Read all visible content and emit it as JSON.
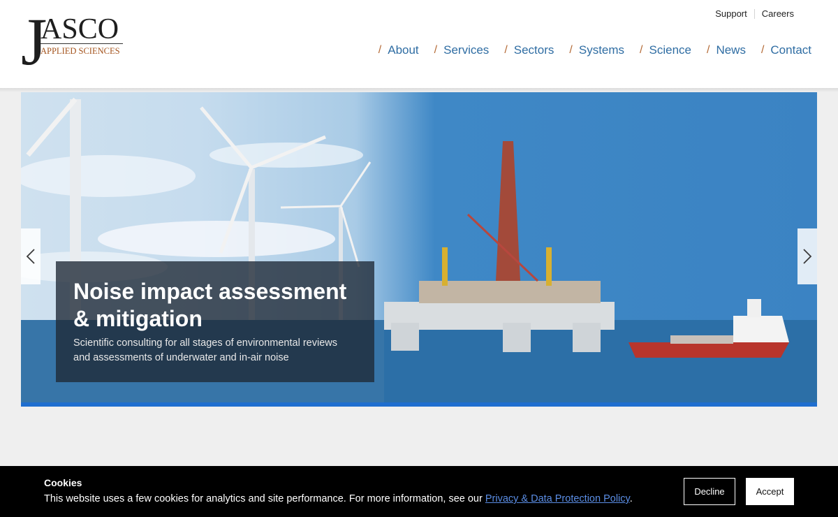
{
  "logo": {
    "initial": "J",
    "rest": "ASCO",
    "tagline": "APPLIED SCIENCES"
  },
  "utility_nav": [
    {
      "label": "Support"
    },
    {
      "label": "Careers"
    }
  ],
  "main_nav": [
    {
      "label": "About"
    },
    {
      "label": "Services"
    },
    {
      "label": "Sectors"
    },
    {
      "label": "Systems"
    },
    {
      "label": "Science"
    },
    {
      "label": "News"
    },
    {
      "label": "Contact"
    }
  ],
  "hero": {
    "title": "Noise impact assessment & mitigation",
    "subtitle": "Scientific consulting for all stages of environmental reviews and assessments of underwater and in-air noise",
    "prev_icon": "chevron-left-icon",
    "next_icon": "chevron-right-icon"
  },
  "cookie_banner": {
    "title": "Cookies",
    "message": "This website uses a few cookies for analytics and site performance. For more information, see our ",
    "link_text": "Privacy & Data Protection Policy",
    "message_end": ".",
    "decline_label": "Decline",
    "accept_label": "Accept"
  },
  "colors": {
    "nav_link": "#2f6da3",
    "nav_slash": "#b46a36",
    "hero_bar": "#1f6ecf",
    "cookie_bg": "#000000"
  }
}
